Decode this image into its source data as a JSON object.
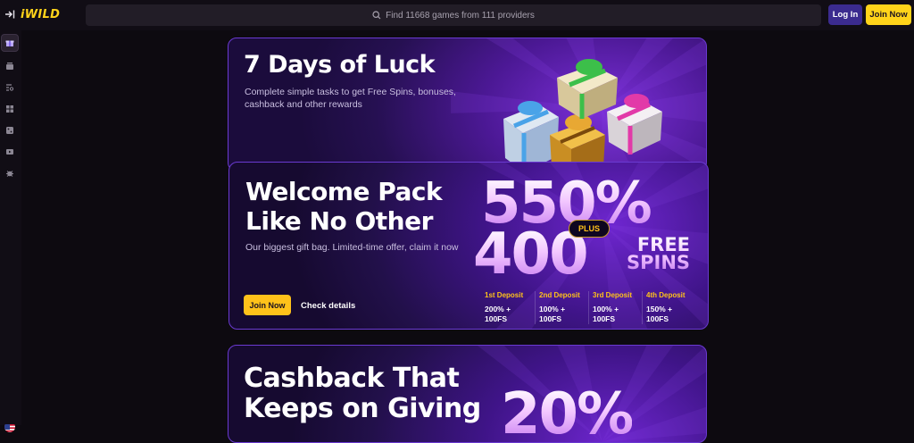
{
  "header": {
    "logo": "iWILD",
    "search_placeholder": "Find 11668 games from 111 providers",
    "login_label": "Log In",
    "join_label": "Join Now"
  },
  "sidebar": {
    "items": [
      "gift-icon",
      "cards-icon",
      "search-list-icon",
      "grid-icon",
      "dice-icon",
      "live-icon",
      "bug-icon"
    ],
    "language": "us-flag"
  },
  "promos": {
    "luck": {
      "title": "7 Days of Luck",
      "subtitle": "Complete simple tasks to get Free Spins, bonuses, cashback and other rewards"
    },
    "welcome": {
      "title": "Welcome Pack Like No Other",
      "subtitle": "Our biggest gift bag. Limited-time offer, claim it now",
      "join_label": "Join Now",
      "details_label": "Check details",
      "percent": "550%",
      "plus": "PLUS",
      "spins": "400",
      "free": "FREE",
      "spins_word": "SPINS",
      "deposits": [
        {
          "label": "1st Deposit",
          "line1": "200% +",
          "line2": "100FS"
        },
        {
          "label": "2nd Deposit",
          "line1": "100% +",
          "line2": "100FS"
        },
        {
          "label": "3rd Deposit",
          "line1": "100% +",
          "line2": "100FS"
        },
        {
          "label": "4th Deposit",
          "line1": "150% +",
          "line2": "100FS"
        }
      ]
    },
    "cashback": {
      "title": "Cashback That Keeps on Giving",
      "percent": "20%"
    }
  },
  "colors": {
    "accent_yellow": "#ffd31a",
    "login_purple": "#3b2b8f",
    "card_border": "#6a3ad1"
  }
}
